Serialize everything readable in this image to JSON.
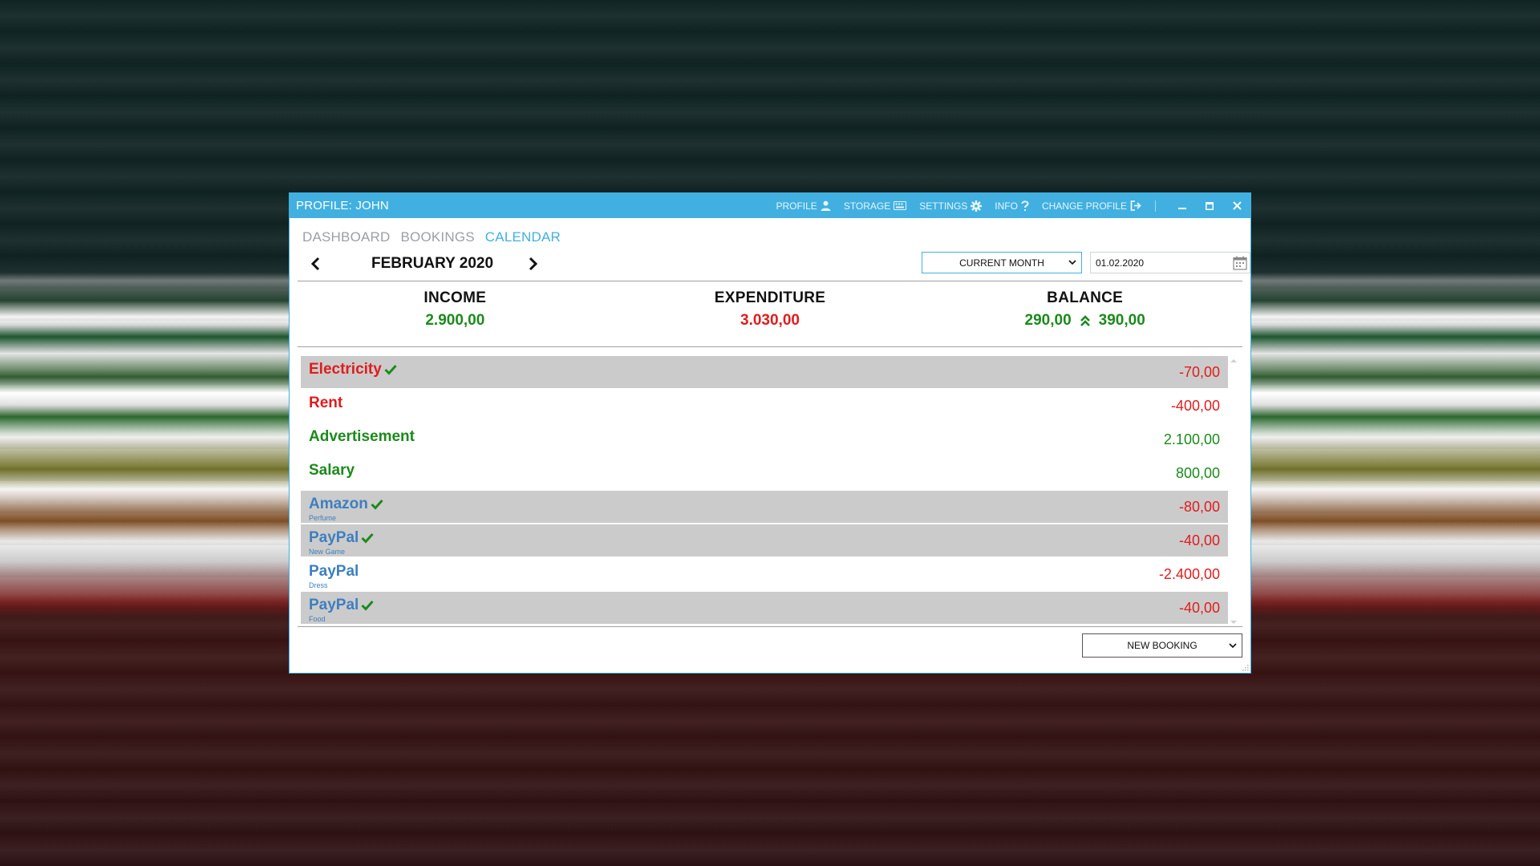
{
  "titlebar": {
    "title": "PROFILE: JOHN",
    "items": [
      {
        "label": "PROFILE",
        "icon": "person-icon"
      },
      {
        "label": "STORAGE",
        "icon": "keyboard-icon"
      },
      {
        "label": "SETTINGS",
        "icon": "gear-icon"
      },
      {
        "label": "INFO",
        "icon": "question-icon"
      },
      {
        "label": "CHANGE PROFILE",
        "icon": "logout-icon"
      }
    ]
  },
  "tabs": [
    "DASHBOARD",
    "BOOKINGS",
    "CALENDAR"
  ],
  "active_tab": "CALENDAR",
  "month": {
    "label": "FEBRUARY 2020",
    "range_value": "CURRENT MONTH",
    "date_value": "01.02.2020"
  },
  "summary": {
    "income_label": "INCOME",
    "income_value": "2.900,00",
    "expenditure_label": "EXPENDITURE",
    "expenditure_value": "3.030,00",
    "balance_label": "BALANCE",
    "balance_value": "290,00",
    "balance_projected": "390,00"
  },
  "bookings": [
    {
      "name": "Electricity",
      "sub": "",
      "amount": "-70,00",
      "checked": true,
      "highlight": true,
      "name_color": "red",
      "amount_color": "red"
    },
    {
      "name": "Rent",
      "sub": "",
      "amount": "-400,00",
      "checked": false,
      "highlight": false,
      "name_color": "red",
      "amount_color": "red"
    },
    {
      "name": "Advertisement",
      "sub": "",
      "amount": "2.100,00",
      "checked": false,
      "highlight": false,
      "name_color": "green",
      "amount_color": "green"
    },
    {
      "name": "Salary",
      "sub": "",
      "amount": "800,00",
      "checked": false,
      "highlight": false,
      "name_color": "green",
      "amount_color": "green"
    },
    {
      "name": "Amazon",
      "sub": "Perfume",
      "amount": "-80,00",
      "checked": true,
      "highlight": true,
      "name_color": "blue",
      "amount_color": "red"
    },
    {
      "name": "PayPal",
      "sub": "New Game",
      "amount": "-40,00",
      "checked": true,
      "highlight": true,
      "name_color": "blue",
      "amount_color": "red"
    },
    {
      "name": "PayPal",
      "sub": "Dress",
      "amount": "-2.400,00",
      "checked": false,
      "highlight": false,
      "name_color": "blue",
      "amount_color": "red"
    },
    {
      "name": "PayPal",
      "sub": "Food",
      "amount": "-40,00",
      "checked": true,
      "highlight": true,
      "name_color": "blue",
      "amount_color": "red"
    }
  ],
  "footer": {
    "new_booking": "NEW BOOKING"
  },
  "colors": {
    "accent": "#41b0e0",
    "income": "#1b8a1b",
    "expense": "#e01c1c",
    "bank": "#3d7fc0",
    "row_highlight": "#cbcbcb"
  }
}
